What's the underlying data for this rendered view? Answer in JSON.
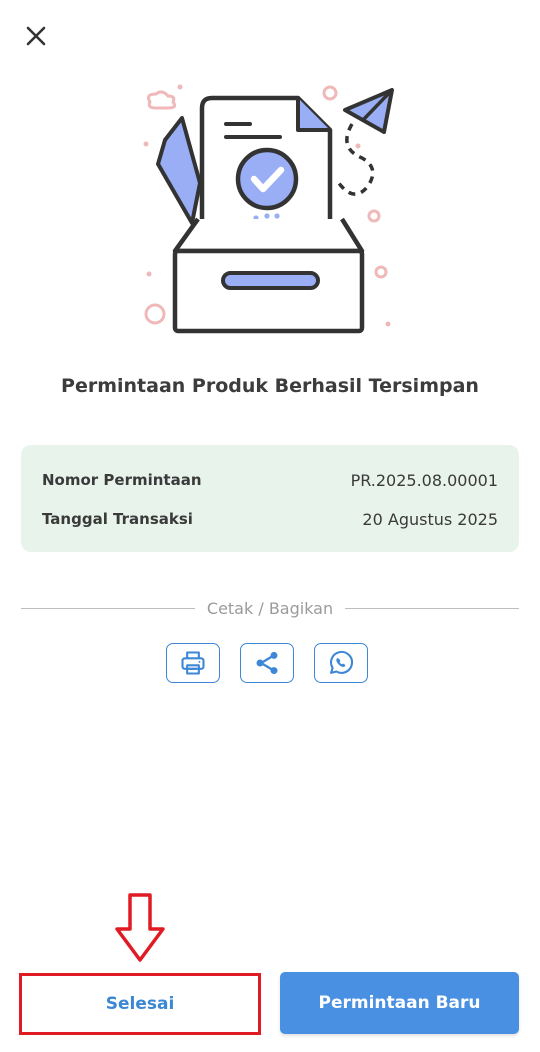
{
  "page": {
    "title": "Permintaan Produk Berhasil Tersimpan"
  },
  "details": [
    {
      "label": "Nomor Permintaan",
      "value": "PR.2025.08.00001"
    },
    {
      "label": "Tanggal Transaksi",
      "value": "20 Agustus 2025"
    }
  ],
  "share": {
    "heading": "Cetak / Bagikan",
    "actions": [
      {
        "icon": "printer-icon"
      },
      {
        "icon": "share-icon"
      },
      {
        "icon": "whatsapp-icon"
      }
    ]
  },
  "footer": {
    "done_label": "Selesai",
    "new_request_label": "Permintaan Baru"
  },
  "colors": {
    "accent": "#4a90e2",
    "card_bg": "#e8f3ec",
    "annotation": "#e01b24",
    "illustration_blue": "#9aaef5",
    "illustration_pink": "#f0b8b8"
  }
}
